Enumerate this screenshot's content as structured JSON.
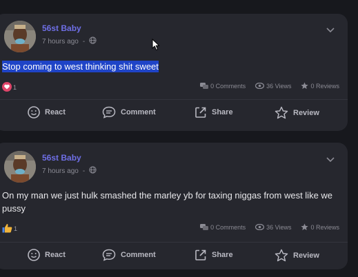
{
  "posts": [
    {
      "author": "56st Baby",
      "time": "7 hours ago",
      "separator": "-",
      "text": "Stop coming to west thinking shit sweet",
      "text_highlighted": true,
      "reaction_count": "1",
      "reaction_icon": "heart-icon",
      "comments": "0 Comments",
      "views": "36 Views",
      "reviews": "0 Reviews"
    },
    {
      "author": "56st Baby",
      "time": "7 hours ago",
      "separator": "-",
      "text": "On my man we just hulk smashed the marley yb for taxing niggas from west like we pussy",
      "text_highlighted": false,
      "reaction_count": "1",
      "reaction_icon": "thumbs-up-icon",
      "comments": "0 Comments",
      "views": "36 Views",
      "reviews": "0 Reviews"
    }
  ],
  "actions": {
    "react": "React",
    "comment": "Comment",
    "share": "Share",
    "review": "Review"
  },
  "colors": {
    "author": "#6f6fe6",
    "highlight": "#1f44c7",
    "card": "#26272e",
    "background": "#17181d"
  }
}
